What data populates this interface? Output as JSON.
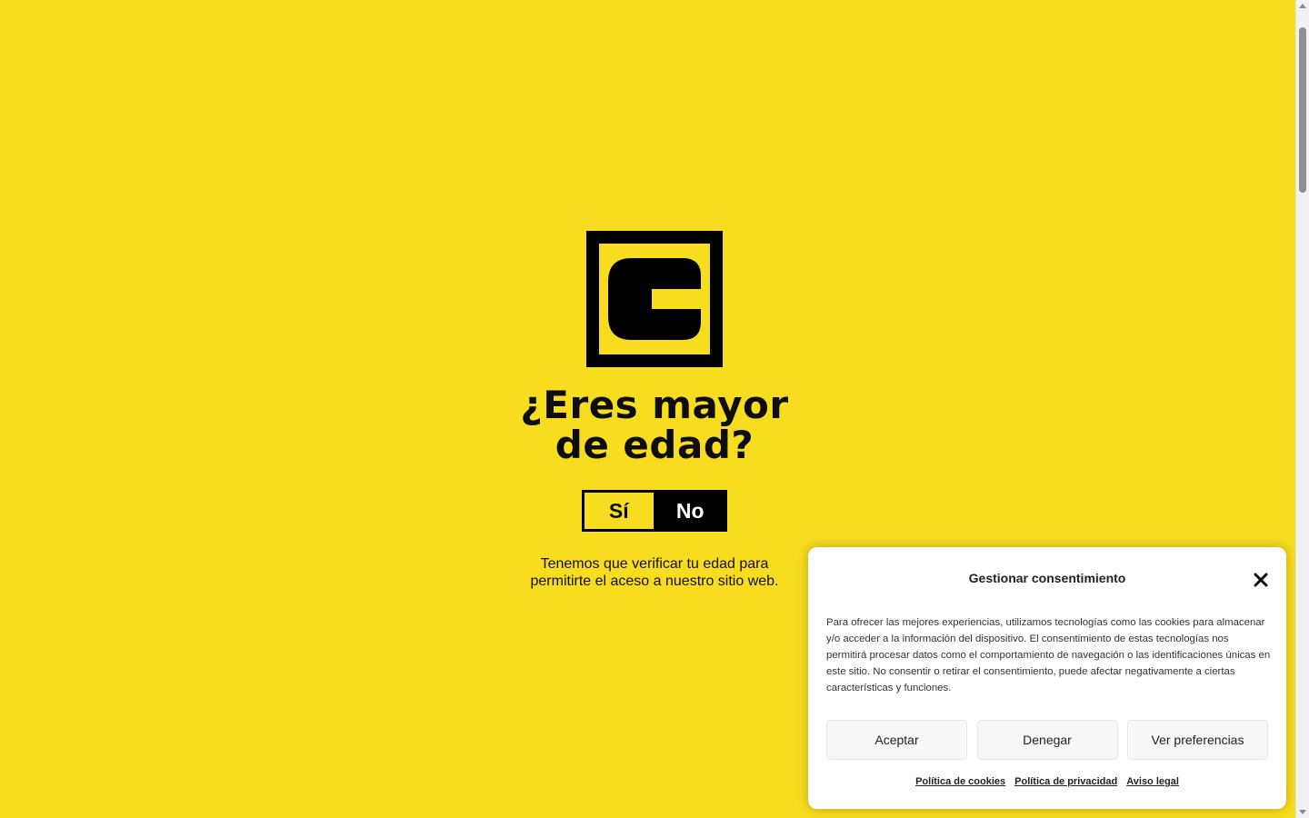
{
  "age_gate": {
    "logo_icon": "brand-logo-icon",
    "headline_line1": "¿Eres mayor",
    "headline_line2": "de edad?",
    "yes_label": "Sí",
    "no_label": "No",
    "note_line1": "Tenemos que verificar tu edad para",
    "note_line2": "permitirte el aceso a nuestro sitio web."
  },
  "consent": {
    "title": "Gestionar consentimiento",
    "close_icon": "close-icon",
    "text": "Para ofrecer las mejores experiencias, utilizamos tecnologías como las cookies para almacenar y/o acceder a la información del dispositivo. El consentimiento de estas tecnologías nos permitirá procesar datos como el comportamiento de navegación o las identificaciones únicas en este sitio. No consentir o retirar el consentimiento, puede afectar negativamente a ciertas características y funciones.",
    "buttons": {
      "accept": "Aceptar",
      "deny": "Denegar",
      "preferences": "Ver preferencias"
    },
    "links": {
      "cookies": "Política de cookies",
      "privacy": "Política de privacidad",
      "legal": "Aviso legal"
    }
  },
  "colors": {
    "background": "#f7dc1f",
    "dark": "#000000",
    "panel": "#ffffff"
  }
}
